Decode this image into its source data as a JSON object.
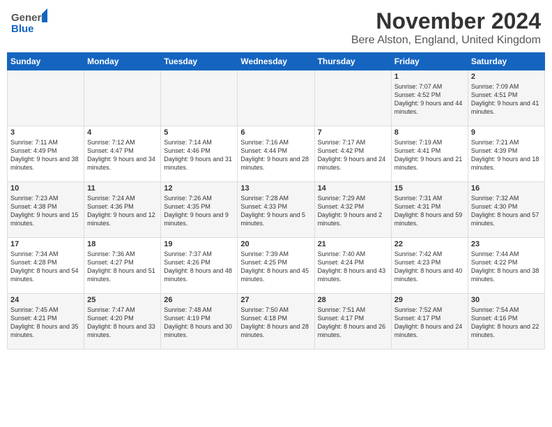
{
  "header": {
    "logo_general": "General",
    "logo_blue": "Blue",
    "month_title": "November 2024",
    "location": "Bere Alston, England, United Kingdom"
  },
  "days_of_week": [
    "Sunday",
    "Monday",
    "Tuesday",
    "Wednesday",
    "Thursday",
    "Friday",
    "Saturday"
  ],
  "weeks": [
    [
      {
        "day": "",
        "sunrise": "",
        "sunset": "",
        "daylight": ""
      },
      {
        "day": "",
        "sunrise": "",
        "sunset": "",
        "daylight": ""
      },
      {
        "day": "",
        "sunrise": "",
        "sunset": "",
        "daylight": ""
      },
      {
        "day": "",
        "sunrise": "",
        "sunset": "",
        "daylight": ""
      },
      {
        "day": "",
        "sunrise": "",
        "sunset": "",
        "daylight": ""
      },
      {
        "day": "1",
        "sunrise": "Sunrise: 7:07 AM",
        "sunset": "Sunset: 4:52 PM",
        "daylight": "Daylight: 9 hours and 44 minutes."
      },
      {
        "day": "2",
        "sunrise": "Sunrise: 7:09 AM",
        "sunset": "Sunset: 4:51 PM",
        "daylight": "Daylight: 9 hours and 41 minutes."
      }
    ],
    [
      {
        "day": "3",
        "sunrise": "Sunrise: 7:11 AM",
        "sunset": "Sunset: 4:49 PM",
        "daylight": "Daylight: 9 hours and 38 minutes."
      },
      {
        "day": "4",
        "sunrise": "Sunrise: 7:12 AM",
        "sunset": "Sunset: 4:47 PM",
        "daylight": "Daylight: 9 hours and 34 minutes."
      },
      {
        "day": "5",
        "sunrise": "Sunrise: 7:14 AM",
        "sunset": "Sunset: 4:46 PM",
        "daylight": "Daylight: 9 hours and 31 minutes."
      },
      {
        "day": "6",
        "sunrise": "Sunrise: 7:16 AM",
        "sunset": "Sunset: 4:44 PM",
        "daylight": "Daylight: 9 hours and 28 minutes."
      },
      {
        "day": "7",
        "sunrise": "Sunrise: 7:17 AM",
        "sunset": "Sunset: 4:42 PM",
        "daylight": "Daylight: 9 hours and 24 minutes."
      },
      {
        "day": "8",
        "sunrise": "Sunrise: 7:19 AM",
        "sunset": "Sunset: 4:41 PM",
        "daylight": "Daylight: 9 hours and 21 minutes."
      },
      {
        "day": "9",
        "sunrise": "Sunrise: 7:21 AM",
        "sunset": "Sunset: 4:39 PM",
        "daylight": "Daylight: 9 hours and 18 minutes."
      }
    ],
    [
      {
        "day": "10",
        "sunrise": "Sunrise: 7:23 AM",
        "sunset": "Sunset: 4:38 PM",
        "daylight": "Daylight: 9 hours and 15 minutes."
      },
      {
        "day": "11",
        "sunrise": "Sunrise: 7:24 AM",
        "sunset": "Sunset: 4:36 PM",
        "daylight": "Daylight: 9 hours and 12 minutes."
      },
      {
        "day": "12",
        "sunrise": "Sunrise: 7:26 AM",
        "sunset": "Sunset: 4:35 PM",
        "daylight": "Daylight: 9 hours and 9 minutes."
      },
      {
        "day": "13",
        "sunrise": "Sunrise: 7:28 AM",
        "sunset": "Sunset: 4:33 PM",
        "daylight": "Daylight: 9 hours and 5 minutes."
      },
      {
        "day": "14",
        "sunrise": "Sunrise: 7:29 AM",
        "sunset": "Sunset: 4:32 PM",
        "daylight": "Daylight: 9 hours and 2 minutes."
      },
      {
        "day": "15",
        "sunrise": "Sunrise: 7:31 AM",
        "sunset": "Sunset: 4:31 PM",
        "daylight": "Daylight: 8 hours and 59 minutes."
      },
      {
        "day": "16",
        "sunrise": "Sunrise: 7:32 AM",
        "sunset": "Sunset: 4:30 PM",
        "daylight": "Daylight: 8 hours and 57 minutes."
      }
    ],
    [
      {
        "day": "17",
        "sunrise": "Sunrise: 7:34 AM",
        "sunset": "Sunset: 4:28 PM",
        "daylight": "Daylight: 8 hours and 54 minutes."
      },
      {
        "day": "18",
        "sunrise": "Sunrise: 7:36 AM",
        "sunset": "Sunset: 4:27 PM",
        "daylight": "Daylight: 8 hours and 51 minutes."
      },
      {
        "day": "19",
        "sunrise": "Sunrise: 7:37 AM",
        "sunset": "Sunset: 4:26 PM",
        "daylight": "Daylight: 8 hours and 48 minutes."
      },
      {
        "day": "20",
        "sunrise": "Sunrise: 7:39 AM",
        "sunset": "Sunset: 4:25 PM",
        "daylight": "Daylight: 8 hours and 45 minutes."
      },
      {
        "day": "21",
        "sunrise": "Sunrise: 7:40 AM",
        "sunset": "Sunset: 4:24 PM",
        "daylight": "Daylight: 8 hours and 43 minutes."
      },
      {
        "day": "22",
        "sunrise": "Sunrise: 7:42 AM",
        "sunset": "Sunset: 4:23 PM",
        "daylight": "Daylight: 8 hours and 40 minutes."
      },
      {
        "day": "23",
        "sunrise": "Sunrise: 7:44 AM",
        "sunset": "Sunset: 4:22 PM",
        "daylight": "Daylight: 8 hours and 38 minutes."
      }
    ],
    [
      {
        "day": "24",
        "sunrise": "Sunrise: 7:45 AM",
        "sunset": "Sunset: 4:21 PM",
        "daylight": "Daylight: 8 hours and 35 minutes."
      },
      {
        "day": "25",
        "sunrise": "Sunrise: 7:47 AM",
        "sunset": "Sunset: 4:20 PM",
        "daylight": "Daylight: 8 hours and 33 minutes."
      },
      {
        "day": "26",
        "sunrise": "Sunrise: 7:48 AM",
        "sunset": "Sunset: 4:19 PM",
        "daylight": "Daylight: 8 hours and 30 minutes."
      },
      {
        "day": "27",
        "sunrise": "Sunrise: 7:50 AM",
        "sunset": "Sunset: 4:18 PM",
        "daylight": "Daylight: 8 hours and 28 minutes."
      },
      {
        "day": "28",
        "sunrise": "Sunrise: 7:51 AM",
        "sunset": "Sunset: 4:17 PM",
        "daylight": "Daylight: 8 hours and 26 minutes."
      },
      {
        "day": "29",
        "sunrise": "Sunrise: 7:52 AM",
        "sunset": "Sunset: 4:17 PM",
        "daylight": "Daylight: 8 hours and 24 minutes."
      },
      {
        "day": "30",
        "sunrise": "Sunrise: 7:54 AM",
        "sunset": "Sunset: 4:16 PM",
        "daylight": "Daylight: 8 hours and 22 minutes."
      }
    ]
  ]
}
